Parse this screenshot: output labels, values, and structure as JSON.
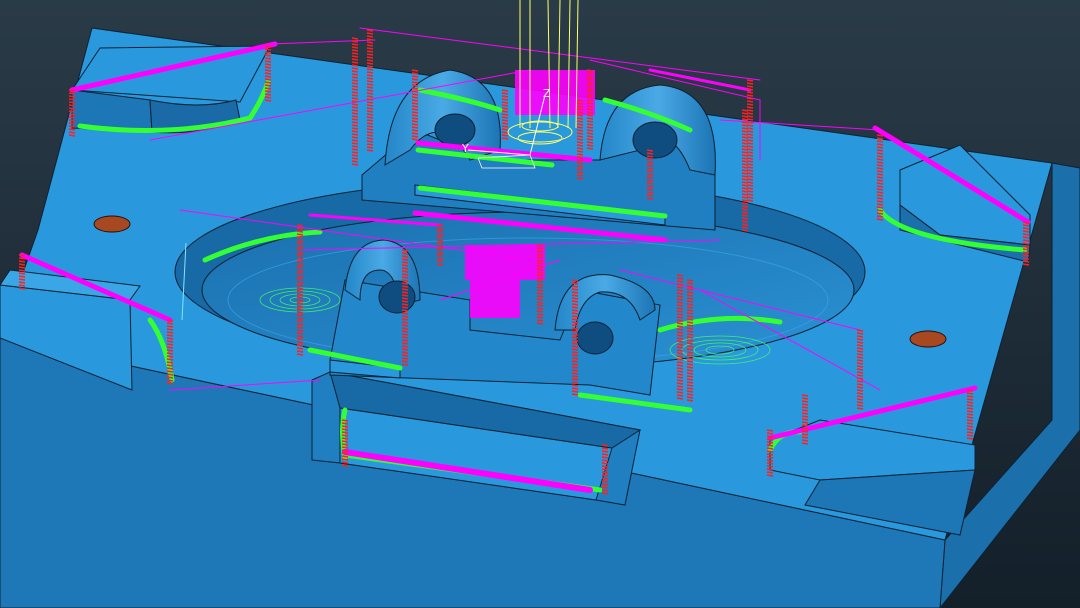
{
  "viewport": {
    "background_top": "#2a3b48",
    "background_bottom": "#131f29"
  },
  "colors": {
    "part_top": "#2a98dc",
    "part_side": "#1f7fc0",
    "part_dark": "#15659e",
    "part_shadow": "#10507f",
    "edge": "#0b2233",
    "toolpath_cut": "#ff00ff",
    "toolpath_finish": "#33ff33",
    "toolpath_plunge": "#ff2020",
    "tool": "#ffff66",
    "hole": "#a84820"
  },
  "triad": {
    "z_label": "Z",
    "y_label": "Y"
  }
}
